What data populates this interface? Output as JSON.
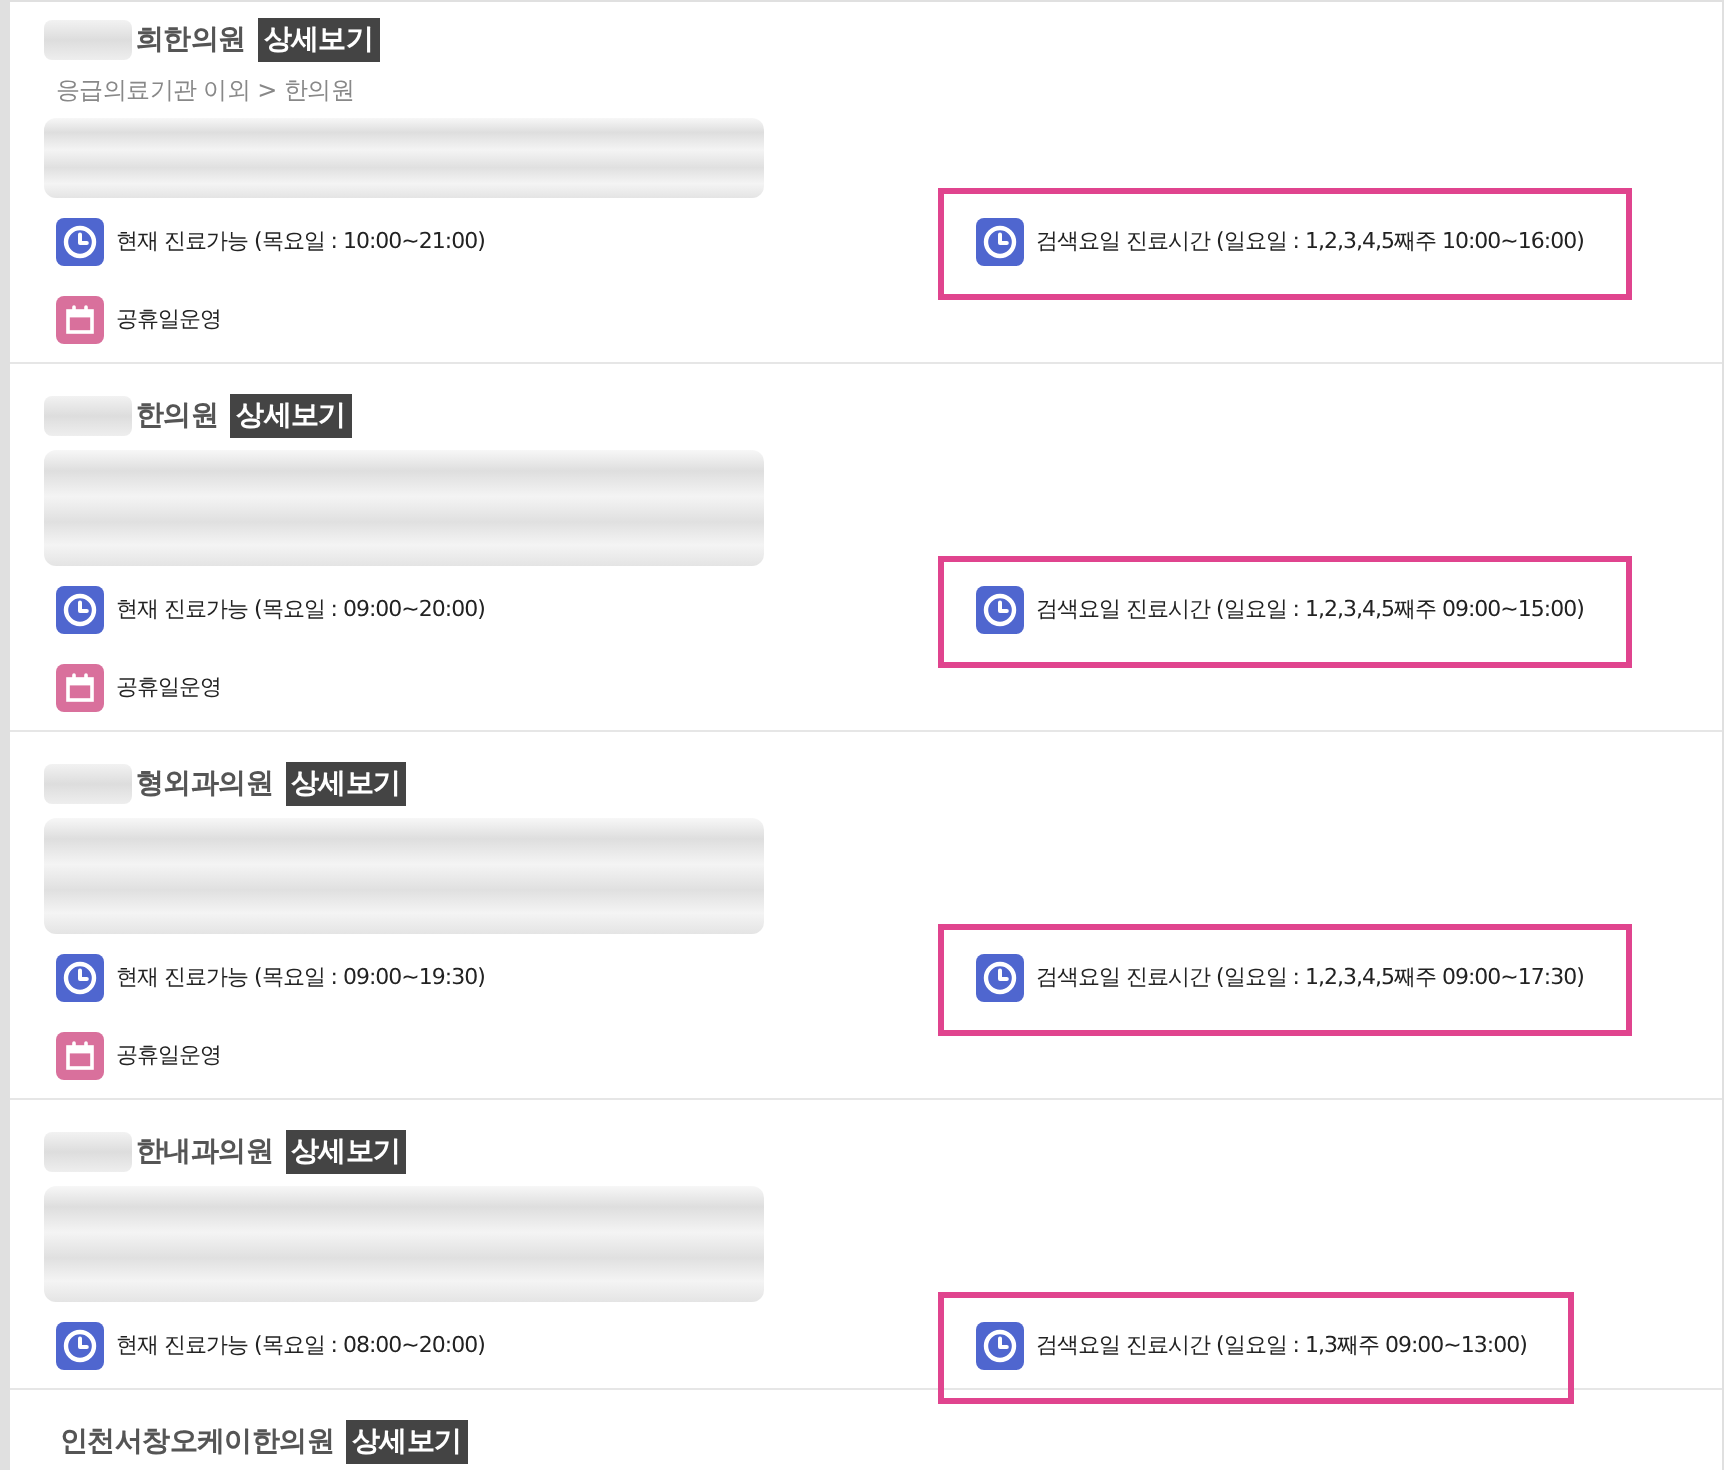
{
  "clinics": [
    {
      "name_masked": true,
      "name": "희한의원",
      "detail_button": "상세보기",
      "category": "응급의료기관 이외 > 한의원",
      "details_masked": true,
      "current_hours": "현재 진료가능 (목요일 : 10:00~21:00)",
      "search_hours": {
        "text": "검색요일 진료시간 (일요일 : 1,2,3,4,5째주 10:00~16:00)",
        "highlighted": true
      },
      "holiday": "공휴일운영"
    },
    {
      "name_masked": true,
      "name": "한의원",
      "detail_button": "상세보기",
      "details_masked": true,
      "current_hours": "현재 진료가능 (목요일 : 09:00~20:00)",
      "search_hours": {
        "text": "검색요일 진료시간 (일요일 : 1,2,3,4,5째주 09:00~15:00)",
        "highlighted": true
      },
      "holiday": "공휴일운영"
    },
    {
      "name_masked": true,
      "name": "형외과의원",
      "detail_button": "상세보기",
      "details_masked": true,
      "current_hours": "현재 진료가능 (목요일 : 09:00~19:30)",
      "search_hours": {
        "text": "검색요일 진료시간 (일요일 : 1,2,3,4,5째주 09:00~17:30)",
        "highlighted": true
      },
      "holiday": "공휴일운영"
    },
    {
      "name_masked": true,
      "name": "한내과의원",
      "detail_button": "상세보기",
      "details_masked": true,
      "current_hours": "현재 진료가능 (목요일 : 08:00~20:00)",
      "search_hours": {
        "text": "검색요일 진료시간 (일요일 : 1,3째주 09:00~13:00)",
        "highlighted": true
      }
    },
    {
      "name_masked": false,
      "name": "인천서창오케이한의원",
      "detail_button": "상세보기",
      "details_masked": false
    }
  ]
}
